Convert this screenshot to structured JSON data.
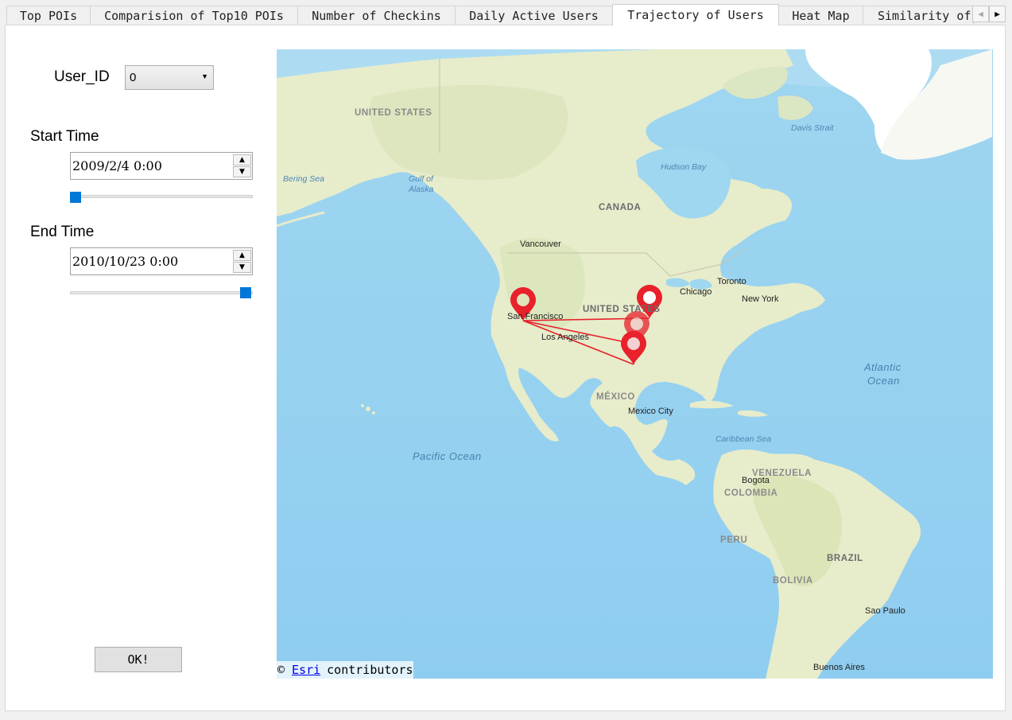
{
  "tabs": [
    {
      "label": "Top POIs",
      "active": false
    },
    {
      "label": "Comparision of Top10 POIs",
      "active": false
    },
    {
      "label": "Number of Checkins",
      "active": false
    },
    {
      "label": "Daily Active Users",
      "active": false
    },
    {
      "label": "Trajectory of Users",
      "active": true
    },
    {
      "label": "Heat Map",
      "active": false
    },
    {
      "label": "Similarity of",
      "active": false
    }
  ],
  "tab_scroll": {
    "left_icon": "triangle-left-icon",
    "right_icon": "triangle-right-icon"
  },
  "controls": {
    "user_id_label": "User_ID",
    "user_id_value": "0",
    "start_label": "Start Time",
    "start_value": "2009/2/4 0:00",
    "start_slider_fraction": 0.0,
    "end_label": "End Time",
    "end_value": "2010/10/23 0:00",
    "end_slider_fraction": 1.0,
    "ok_label": "OK!"
  },
  "map": {
    "labels": {
      "united_states_ak": "UNITED STATES",
      "canada": "CANADA",
      "united_states": "UNITED STATES",
      "mexico": "MÉXICO",
      "venezuela": "VENEZUELA",
      "colombia": "COLOMBIA",
      "peru": "PERU",
      "brazil": "BRAZIL",
      "bolivia": "BOLIVIA",
      "bering_sea": "Bering Sea",
      "gulf_of_alaska_1": "Gulf of",
      "gulf_of_alaska_2": "Alaska",
      "hudson_bay": "Hudson Bay",
      "davis_strait": "Davis Strait",
      "caribbean_sea": "Caribbean Sea",
      "pacific_ocean": "Pacific Ocean",
      "atlantic_1": "Atlantic",
      "atlantic_2": "Ocean",
      "vancouver": "Vancouver",
      "toronto": "Toronto",
      "chicago": "Chicago",
      "new_york": "New York",
      "san_francisco": "San Francisco",
      "los_angeles": "Los Angeles",
      "mexico_city": "Mexico City",
      "bogota": "Bogota",
      "sao_paulo": "Sao Paulo",
      "buenos_aires": "Buenos Aires"
    },
    "attribution_prefix": "©",
    "attribution_link": "Esri",
    "attribution_suffix": "contributors",
    "marker_color": "#e8212b",
    "route_color": "#e8212b"
  }
}
